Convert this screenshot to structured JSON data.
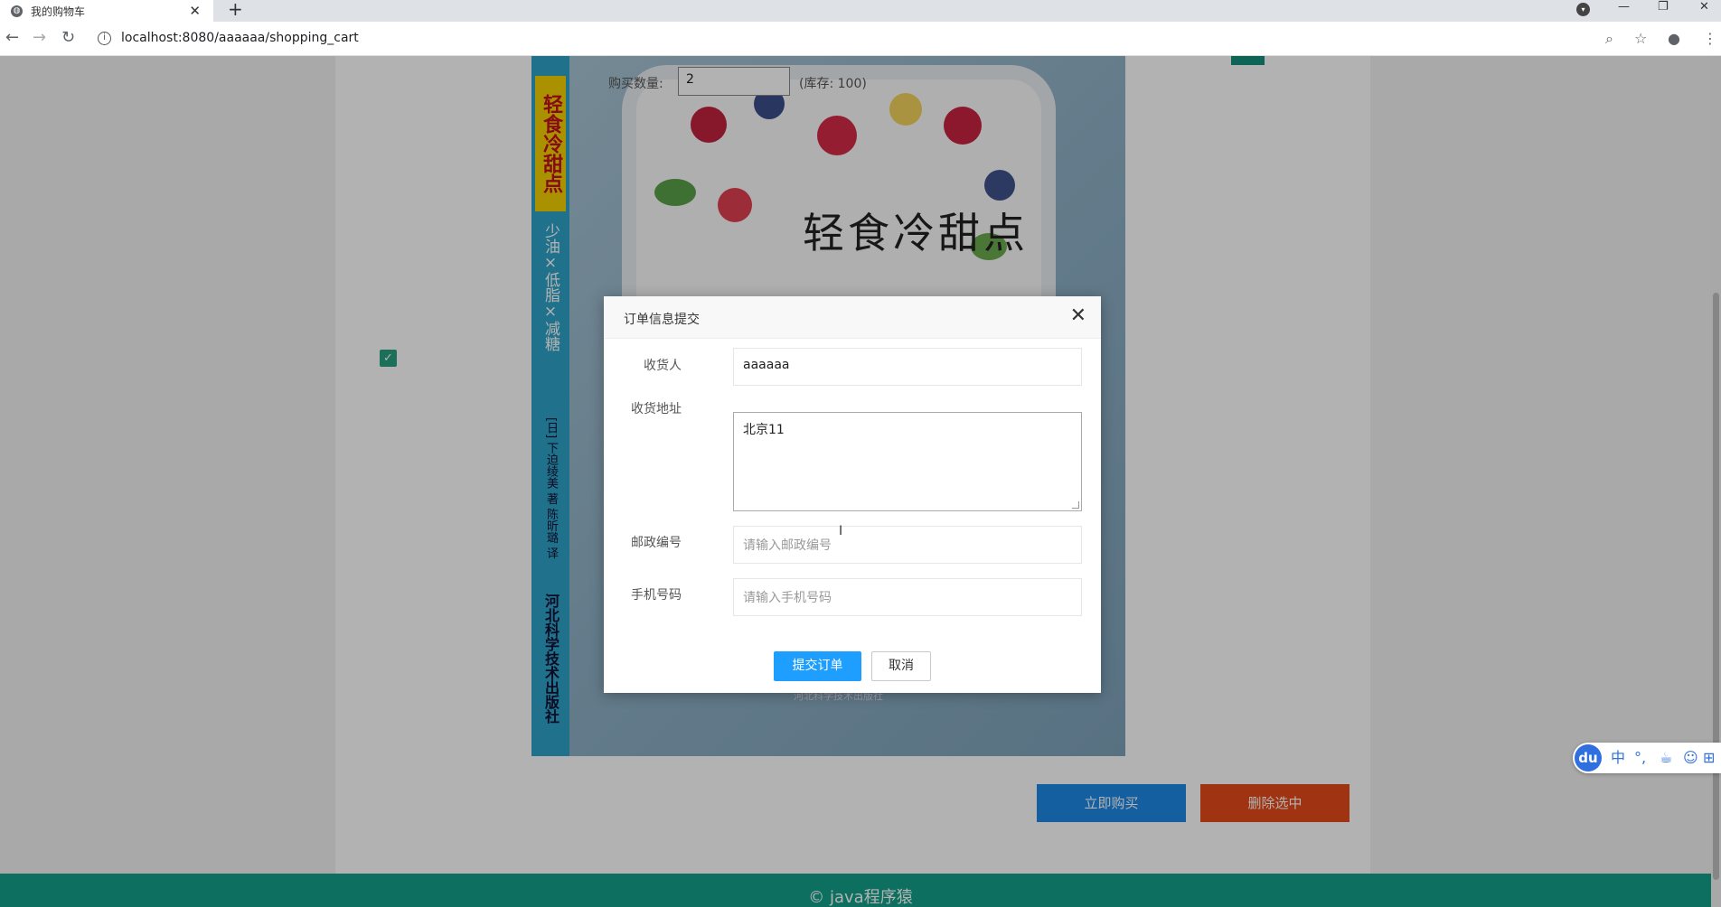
{
  "browser": {
    "tab_title": "我的购物车",
    "url": "localhost:8080/aaaaaa/shopping_cart"
  },
  "cart": {
    "quantity_label": "购买数量:",
    "quantity_value": "2",
    "stock_text": "(库存: 100)"
  },
  "book_cover": {
    "spine_title": "轻食冷甜点",
    "spine_subtitle": "少油×低脂×减糖",
    "spine_author": "[日] 下迫绫美 著 陈昕璐 译",
    "spine_publisher": "河北科学技术出版社",
    "cover_title": "轻食冷甜点",
    "cover_publisher": "河北科学技术出版社"
  },
  "actions": {
    "buy_now": "立即购买",
    "delete_selected": "删除选中"
  },
  "footer": {
    "text": "© java程序猿"
  },
  "modal": {
    "title": "订单信息提交",
    "fields": [
      {
        "label": "收货人",
        "value": "aaaaaa",
        "placeholder": ""
      },
      {
        "label": "收货地址",
        "value": "北京11",
        "placeholder": ""
      },
      {
        "label": "邮政编号",
        "value": "",
        "placeholder": "请输入邮政编号"
      },
      {
        "label": "手机号码",
        "value": "",
        "placeholder": "请输入手机号码"
      }
    ],
    "submit": "提交订单",
    "cancel": "取消"
  },
  "ime_toolbar": {
    "logo": "du",
    "mode": "中",
    "punct": "°,",
    "items": [
      "cup-icon",
      "user-icon",
      "grid-icon"
    ]
  },
  "colors": {
    "buy_button": "#1e88e5",
    "delete_button": "#e64a19",
    "footer": "#14a08a",
    "submit_button": "#1e9fff"
  }
}
